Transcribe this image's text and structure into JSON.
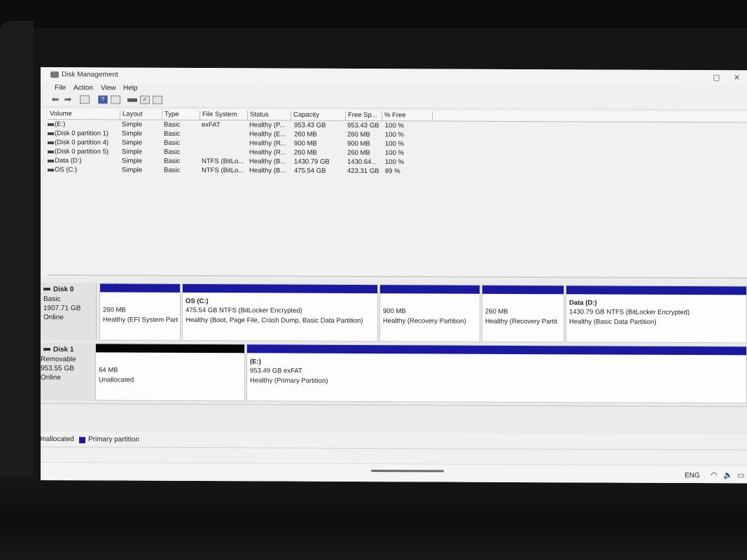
{
  "window": {
    "title": "Disk Management",
    "minimize_glyph": "–",
    "maximize_glyph": "▢",
    "close_glyph": "✕"
  },
  "menu": [
    "File",
    "Action",
    "View",
    "Help"
  ],
  "toolbar": {
    "icons": [
      "back-arrow-icon",
      "forward-arrow-icon",
      "console-tree-icon",
      "help-icon",
      "properties-icon",
      "connect-icon",
      "check-icon",
      "list-icon"
    ]
  },
  "columns": [
    "Volume",
    "Layout",
    "Type",
    "File System",
    "Status",
    "Capacity",
    "Free Sp...",
    "% Free"
  ],
  "volumes": [
    {
      "volume": "(E:)",
      "layout": "Simple",
      "type": "Basic",
      "fs": "exFAT",
      "status": "Healthy (P...",
      "capacity": "953.43 GB",
      "free": "953.43 GB",
      "pct": "100 %"
    },
    {
      "volume": "(Disk 0 partition 1)",
      "layout": "Simple",
      "type": "Basic",
      "fs": "",
      "status": "Healthy (E...",
      "capacity": "260 MB",
      "free": "260 MB",
      "pct": "100 %"
    },
    {
      "volume": "(Disk 0 partition 4)",
      "layout": "Simple",
      "type": "Basic",
      "fs": "",
      "status": "Healthy (R...",
      "capacity": "900 MB",
      "free": "900 MB",
      "pct": "100 %"
    },
    {
      "volume": "(Disk 0 partition 5)",
      "layout": "Simple",
      "type": "Basic",
      "fs": "",
      "status": "Healthy (R...",
      "capacity": "260 MB",
      "free": "260 MB",
      "pct": "100 %"
    },
    {
      "volume": "Data (D:)",
      "layout": "Simple",
      "type": "Basic",
      "fs": "NTFS (BitLo...",
      "status": "Healthy (B...",
      "capacity": "1430.79 GB",
      "free": "1430.64...",
      "pct": "100 %"
    },
    {
      "volume": "OS (C:)",
      "layout": "Simple",
      "type": "Basic",
      "fs": "NTFS (BitLo...",
      "status": "Healthy (B...",
      "capacity": "475.54 GB",
      "free": "423.31 GB",
      "pct": "89 %"
    }
  ],
  "disks": [
    {
      "name": "Disk 0",
      "kind": "Basic",
      "size": "1907.71 GB",
      "state": "Online",
      "partitions": [
        {
          "title": "",
          "line1": "260 MB",
          "line2": "Healthy (EFI System Part",
          "bar": "#1a1aa0"
        },
        {
          "title": "OS  (C:)",
          "line1": "475.54 GB NTFS (BitLocker Encrypted)",
          "line2": "Healthy (Boot, Page File, Crash Dump, Basic Data Partition)",
          "bar": "#1a1aa0"
        },
        {
          "title": "",
          "line1": "900 MB",
          "line2": "Healthy (Recovery Partition)",
          "bar": "#1a1aa0"
        },
        {
          "title": "",
          "line1": "260 MB",
          "line2": "Healthy (Recovery Partit",
          "bar": "#1a1aa0"
        },
        {
          "title": "Data  (D:)",
          "line1": "1430.79 GB NTFS (BitLocker Encrypted)",
          "line2": "Healthy (Basic Data Partition)",
          "bar": "#1a1aa0"
        }
      ]
    },
    {
      "name": "Disk 1",
      "kind": "Removable",
      "size": "953.55 GB",
      "state": "Online",
      "partitions": [
        {
          "title": "",
          "line1": "64 MB",
          "line2": "Unallocated",
          "bar": "#050505"
        },
        {
          "title": "(E:)",
          "line1": "953.49 GB exFAT",
          "line2": "Healthy (Primary Partition)",
          "bar": "#1a1aa0"
        }
      ]
    }
  ],
  "legend": [
    {
      "label": "Unallocated",
      "color": "#050505"
    },
    {
      "label": "Primary partition",
      "color": "#1a1aa0"
    }
  ],
  "taskbar": {
    "language": "ENG",
    "tray_icons": [
      "wifi-icon",
      "volume-icon",
      "battery-icon"
    ]
  }
}
